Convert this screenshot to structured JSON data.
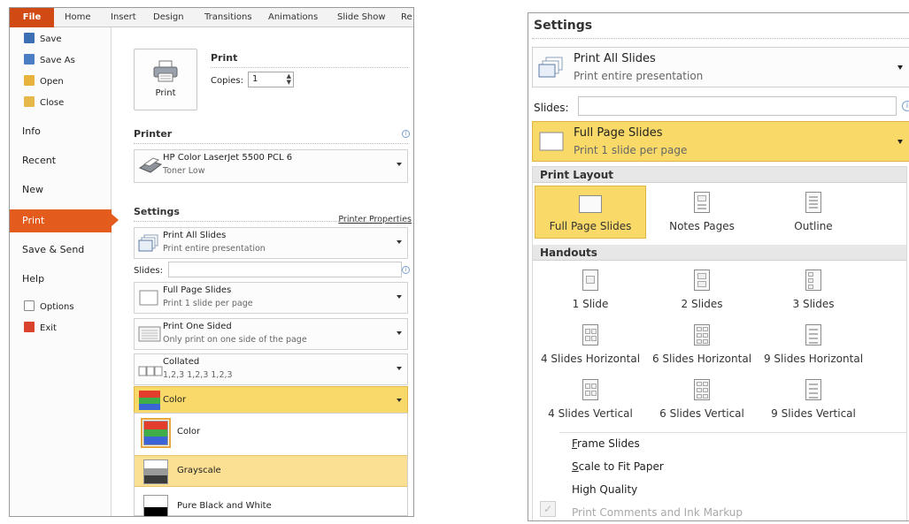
{
  "left": {
    "ribbon_tabs": [
      "File",
      "Home",
      "Insert",
      "Design",
      "Transitions",
      "Animations",
      "Slide Show",
      "Re"
    ],
    "backstage": {
      "top_items": [
        {
          "label": "Save",
          "icon": "save-icon"
        },
        {
          "label": "Save As",
          "icon": "save-as-icon"
        },
        {
          "label": "Open",
          "icon": "open-folder-icon"
        },
        {
          "label": "Close",
          "icon": "close-folder-icon"
        }
      ],
      "main_items": [
        "Info",
        "Recent",
        "New",
        "Print",
        "Save & Send",
        "Help"
      ],
      "bottom_items": [
        {
          "label": "Options",
          "icon": "options-icon"
        },
        {
          "label": "Exit",
          "icon": "exit-icon"
        }
      ],
      "active": "Print"
    },
    "print": {
      "button_label": "Print",
      "title": "Print",
      "copies_label": "Copies:",
      "copies_value": "1"
    },
    "printer": {
      "header": "Printer",
      "name": "HP Color LaserJet 5500 PCL 6",
      "status": "Toner Low",
      "properties_link": "Printer Properties"
    },
    "settings": {
      "header": "Settings",
      "print_range": {
        "title": "Print All Slides",
        "subtitle": "Print entire presentation"
      },
      "slides_label": "Slides:",
      "layout": {
        "title": "Full Page Slides",
        "subtitle": "Print 1 slide per page"
      },
      "sides": {
        "title": "Print One Sided",
        "subtitle": "Only print on one side of the page"
      },
      "collation": {
        "title": "Collated",
        "subtitle": "1,2,3   1,2,3   1,2,3"
      },
      "color": {
        "title": "Color"
      }
    },
    "color_menu": [
      "Color",
      "Grayscale",
      "Pure Black and White"
    ]
  },
  "right": {
    "settings_header": "Settings",
    "print_range": {
      "title": "Print All Slides",
      "subtitle": "Print entire presentation"
    },
    "slides_label": "Slides:",
    "layout": {
      "title": "Full Page Slides",
      "subtitle": "Print 1 slide per page"
    },
    "gallery": {
      "print_layout_header": "Print Layout",
      "print_layout_items": [
        "Full Page Slides",
        "Notes Pages",
        "Outline"
      ],
      "handouts_header": "Handouts",
      "handouts_row1": [
        "1 Slide",
        "2 Slides",
        "3 Slides"
      ],
      "handouts_row2": [
        "4 Slides Horizontal",
        "6 Slides Horizontal",
        "9 Slides Horizontal"
      ],
      "handouts_row3": [
        "4 Slides Vertical",
        "6 Slides Vertical",
        "9 Slides Vertical"
      ],
      "options": {
        "frame": {
          "prefix": "",
          "accel": "F",
          "rest": "rame Slides"
        },
        "scale": {
          "prefix": "",
          "accel": "S",
          "rest": "cale to Fit Paper"
        },
        "quality": "High Quality",
        "comments": "Print Comments and Ink Markup"
      }
    }
  },
  "colors": {
    "file_tab": "#d14a14",
    "print_active": "#e35b1d",
    "highlight": "#f9d968",
    "hover": "#fbe094"
  }
}
